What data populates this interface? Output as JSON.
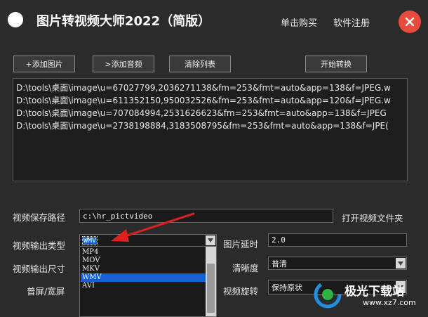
{
  "header": {
    "title": "图片转视频大师2022（简版）",
    "buy_label": "单击购买",
    "register_label": "软件注册"
  },
  "toolbar": {
    "add_image": "+添加图片",
    "add_audio": ">添加音频",
    "clear_list": "清除列表",
    "start_convert": "开始转换"
  },
  "file_list": [
    "D:\\tools\\桌面\\image\\u=67027799,2036271138&fm=253&fmt=auto&app=138&f=JPEG.w",
    "D:\\tools\\桌面\\image\\u=611352150,950032526&fm=253&fmt=auto&app=120&f=JPEG.w",
    "D:\\tools\\桌面\\image\\u=707084994,2531626623&fm=253&fmt=auto&app=138&f=JPEG",
    "D:\\tools\\桌面\\image\\u=2738198884,3183508795&fm=253&fmt=auto&app=138&f=JPE("
  ],
  "settings": {
    "save_path_label": "视频保存路径",
    "save_path_value": "c:\\hr_pictvideo",
    "open_folder_label": "打开视频文件夹",
    "output_type_label": "视频输出类型",
    "output_type_value": "WMV",
    "image_delay_label": "图片延时",
    "image_delay_value": "2.0",
    "output_size_label": "视频输出尺寸",
    "clarity_label": "清晰度",
    "clarity_value": "普清",
    "aspect_label": "普屏/宽屏",
    "rotate_label": "视频旋转",
    "rotate_value": "保持原状"
  },
  "format_options": [
    "MP4",
    "MOV",
    "MKV",
    "WMV",
    "AVI"
  ],
  "watermark": {
    "brand": "极光下载站",
    "url": "www.xz7.com"
  },
  "colors": {
    "background": "#2b2b2b",
    "close": "#e84a3c",
    "selection": "#1460d6",
    "arrow": "#e02020"
  }
}
